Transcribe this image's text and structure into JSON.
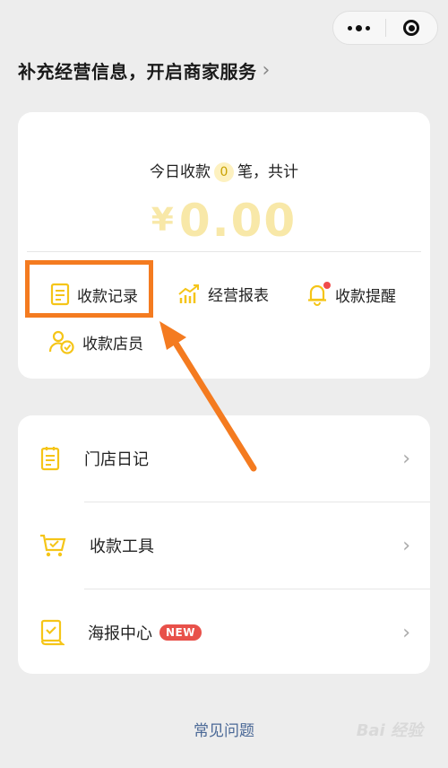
{
  "headline": {
    "text": "补充经营信息，开启商家服务",
    "chevron": "›"
  },
  "summary": {
    "prefix": "今日收款",
    "count": "0",
    "suffix": "笔，共计",
    "currency": "¥",
    "amount": "0.00"
  },
  "quick_actions": [
    {
      "label": "收款记录",
      "icon": "receipt-icon"
    },
    {
      "label": "经营报表",
      "icon": "chart-icon"
    },
    {
      "label": "收款提醒",
      "icon": "bell-icon",
      "has_dot": true
    },
    {
      "label": "收款店员",
      "icon": "staff-icon"
    }
  ],
  "menu": [
    {
      "label": "门店日记",
      "icon": "diary-icon"
    },
    {
      "label": "收款工具",
      "icon": "cart-icon"
    },
    {
      "label": "海报中心",
      "icon": "poster-icon",
      "badge": "NEW"
    }
  ],
  "footer": {
    "faq": "常见问题",
    "watermark": "Bai 经验"
  },
  "colors": {
    "accent": "#f5c518",
    "highlight": "#f47b20",
    "badge_red": "#e8514a",
    "link": "#4a6896"
  }
}
